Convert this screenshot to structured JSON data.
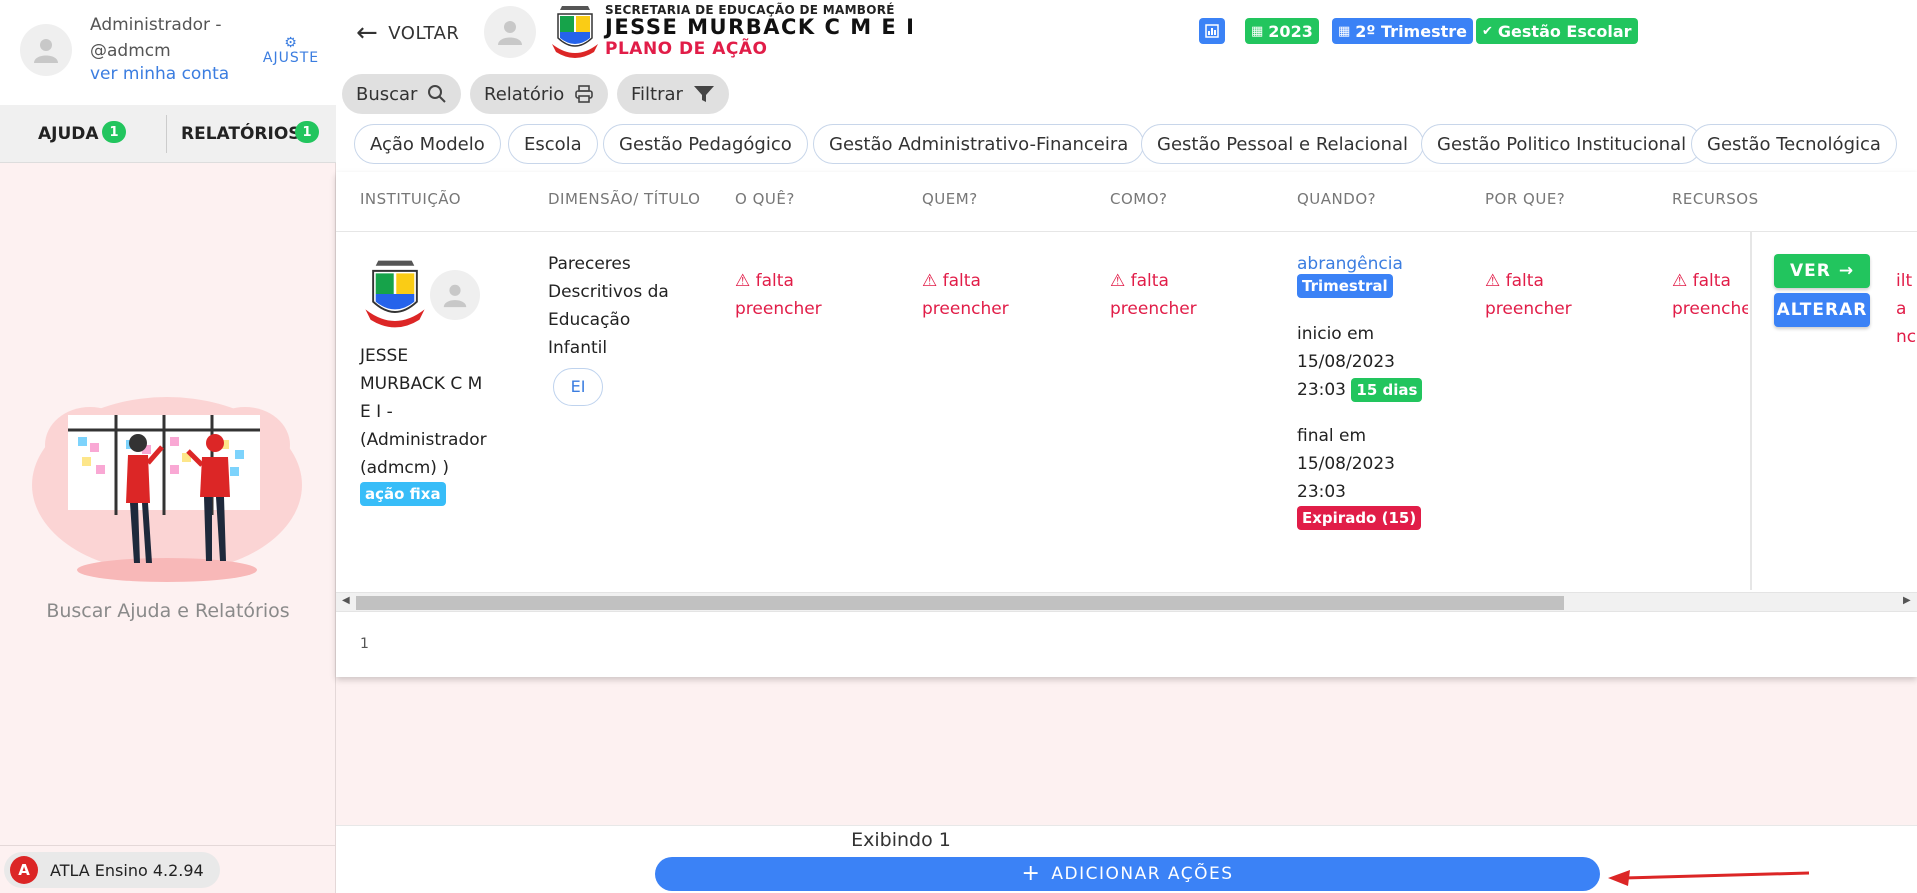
{
  "sidebar": {
    "user_name": "Administrador - @admcm",
    "account_link": "ver minha conta",
    "settings_label": "AJUSTE",
    "tabs": [
      {
        "label": "AJUDA",
        "badge": "1"
      },
      {
        "label": "RELATÓRIOS",
        "badge": "1"
      }
    ],
    "help_text": "Buscar Ajuda e Relatórios",
    "version": "ATLA Ensino 4.2.94"
  },
  "header": {
    "back_label": "VOLTAR",
    "institution_sub": "SECRETARIA DE EDUCAÇÃO DE MAMBORÉ",
    "institution_title": "JESSE MURBACK C M E I",
    "page_title": "PLANO DE AÇÃO",
    "chips": {
      "year": "2023",
      "term": "2º Trimestre",
      "mode": "Gestão Escolar"
    }
  },
  "toolbar": {
    "search_label": "Buscar",
    "report_label": "Relatório",
    "filter_label": "Filtrar"
  },
  "filters": [
    "Ação Modelo",
    "Escola",
    "Gestão Pedagógico",
    "Gestão Administrativo-Financeira",
    "Gestão Pessoal e Relacional",
    "Gestão Politico Institucional",
    "Gestão Tecnológica"
  ],
  "table": {
    "columns": [
      "INSTITUIÇÃO",
      "DIMENSÃO/ TÍTULO",
      "O QUÊ?",
      "QUEM?",
      "COMO?",
      "QUANDO?",
      "POR QUE?",
      "RECURSOS"
    ],
    "rows": [
      {
        "institution": "JESSE MURBACK C M E I - (Administrador (admcm) )",
        "institution_badge": "ação fixa",
        "title": "Pareceres Descritivos da Educação Infantil",
        "title_tag": "EI",
        "what": "falta preencher",
        "who": "falta preencher",
        "how": "falta preencher",
        "when": {
          "scope_label": "abrangência",
          "scope_badge": "Trimestral",
          "start_label": "inicio em",
          "start_date": "15/08/2023",
          "start_time": "23:03",
          "duration_badge": "15 dias",
          "end_label": "final em",
          "end_date": "15/08/2023",
          "end_time": "23:03",
          "status_badge": "Expirado (15)"
        },
        "why": "falta preencher",
        "resources": "falta preenche",
        "overflow_text": "ilta nc",
        "view_label": "VER",
        "edit_label": "ALTERAR"
      }
    ],
    "pager": "1"
  },
  "footer": {
    "count_text": "Exibindo 1",
    "add_label": "ADICIONAR AÇÕES"
  },
  "colors": {
    "accent_blue": "#3b82f6",
    "success_green": "#22c55e",
    "danger_red": "#e11d48",
    "sidebar_bg": "#fdf1f1"
  }
}
